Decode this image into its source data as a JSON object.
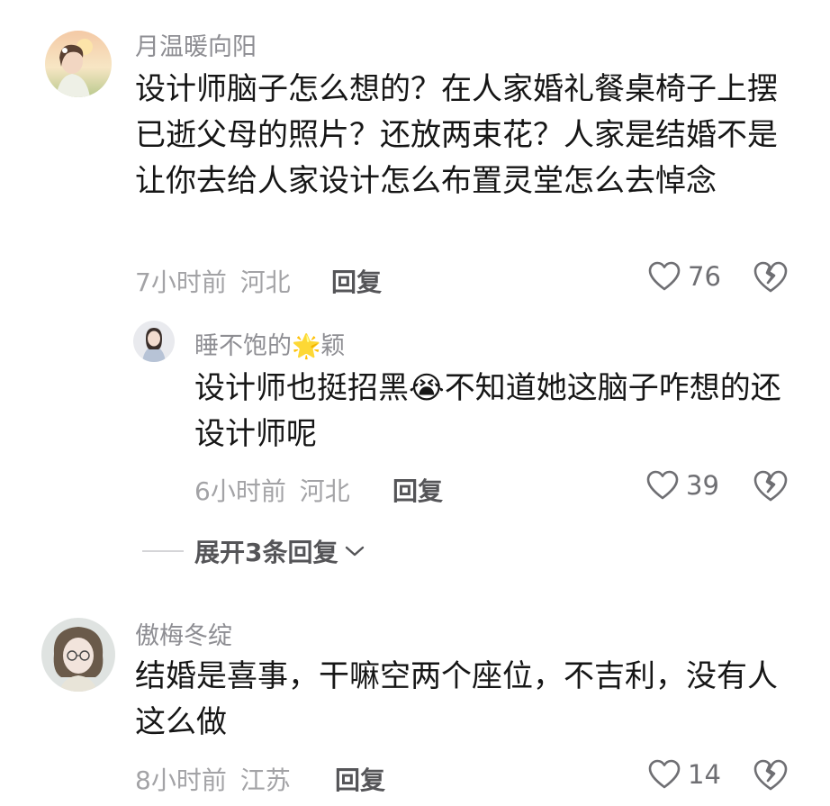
{
  "comments": [
    {
      "username": "月温暖向阳",
      "text": "设计师脑子怎么想的？在人家婚礼餐桌椅子上摆已逝父母的照片？还放两束花？人家是结婚不是让你去给人家设计怎么布置灵堂怎么去悼念",
      "time": "7小时前",
      "location": "河北",
      "reply_label": "回复",
      "likes": "76",
      "reply": {
        "username_prefix": "睡不饱的",
        "username_emoji": "🌟",
        "username_suffix": "颖",
        "text_part1": "设计师也挺招黑",
        "emoji": "😭",
        "text_part2": "不知道她这脑子咋想的还设计师呢",
        "time": "6小时前",
        "location": "河北",
        "reply_label": "回复",
        "likes": "39"
      },
      "expand_label": "展开3条回复"
    },
    {
      "username": "傲梅冬绽",
      "text": "结婚是喜事，干嘛空两个座位，不吉利，没有人这么做",
      "time": "8小时前",
      "location": "江苏",
      "reply_label": "回复",
      "likes": "14"
    }
  ],
  "colors": {
    "username": "#8e8e93",
    "text": "#161616",
    "meta": "#a3a3a6",
    "action": "#555558"
  }
}
